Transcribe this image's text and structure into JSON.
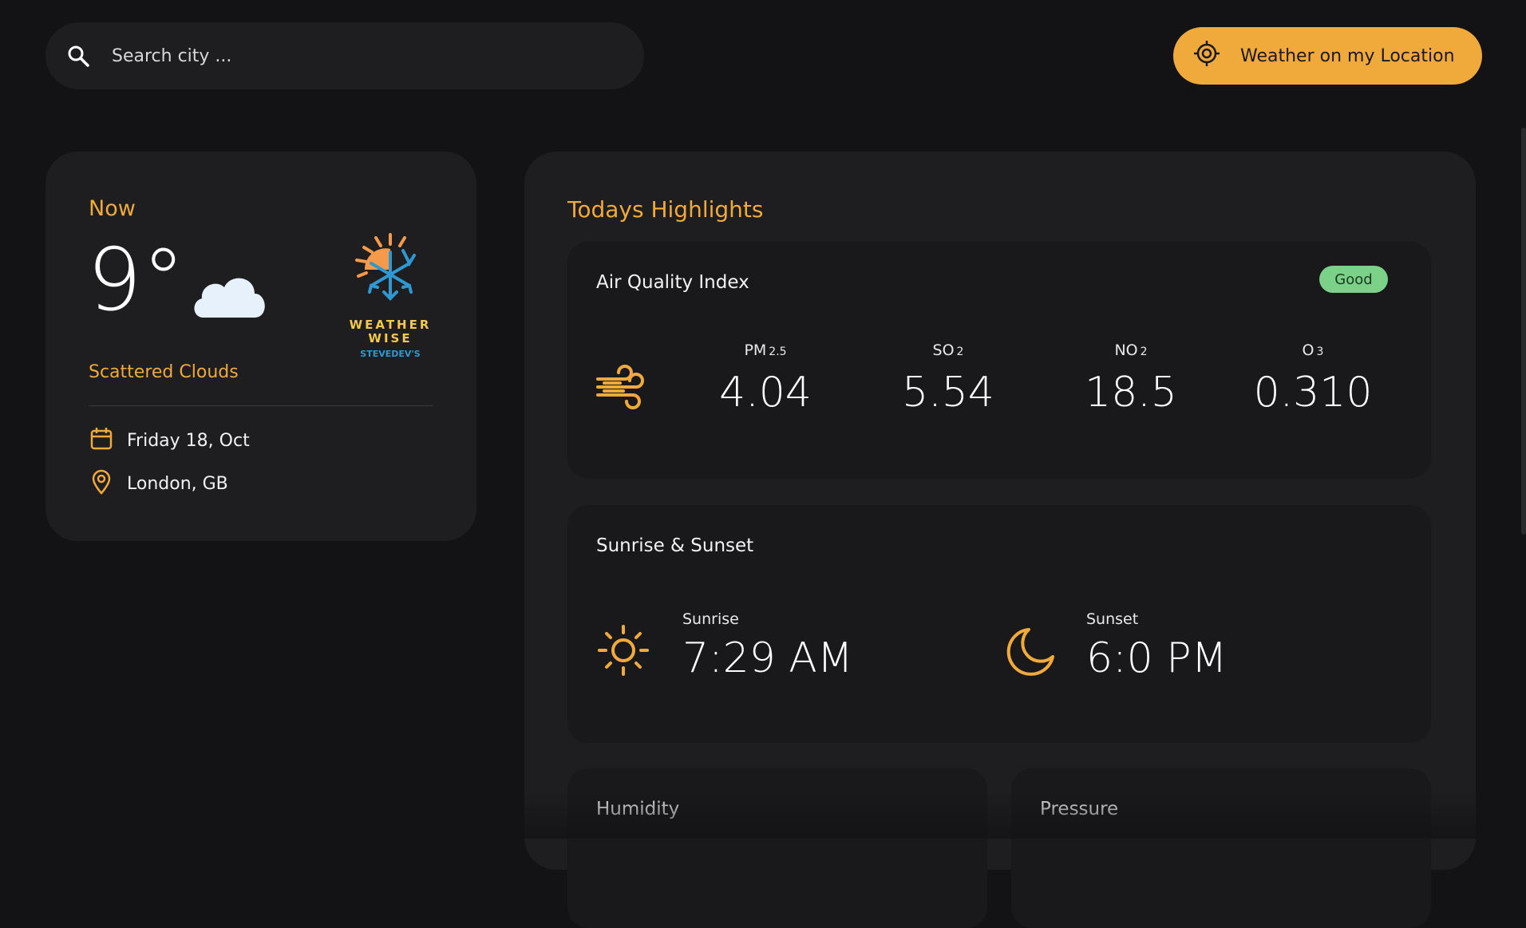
{
  "search": {
    "placeholder": "Search city ..."
  },
  "location_button": {
    "label": "Weather on my Location"
  },
  "now": {
    "title": "Now",
    "temperature": "9°",
    "condition": "Scattered Clouds",
    "date": "Friday 18, Oct",
    "location": "London, GB",
    "logo": {
      "line1": "WEATHER",
      "line2": "WISE",
      "line3": "STEVEDEV'S"
    }
  },
  "highlights": {
    "title": "Todays Highlights",
    "air_quality": {
      "title": "Air Quality Index",
      "badge": "Good",
      "pollutants": [
        {
          "name": "PM",
          "sub": "2.5",
          "value": "4.04"
        },
        {
          "name": "SO",
          "sub": "2",
          "value": "5.54"
        },
        {
          "name": "NO",
          "sub": "2",
          "value": "18.5"
        },
        {
          "name": "O",
          "sub": "3",
          "value": "0.310"
        }
      ]
    },
    "sun": {
      "title": "Sunrise & Sunset",
      "sunrise_label": "Sunrise",
      "sunrise_value": "7:29 AM",
      "sunset_label": "Sunset",
      "sunset_value": "6:0 PM"
    },
    "humidity": {
      "title": "Humidity"
    },
    "pressure": {
      "title": "Pressure"
    }
  },
  "colors": {
    "accent": "#f0a93b",
    "background": "#131315",
    "card": "#1e1e20",
    "good_badge": "#7ad187"
  }
}
